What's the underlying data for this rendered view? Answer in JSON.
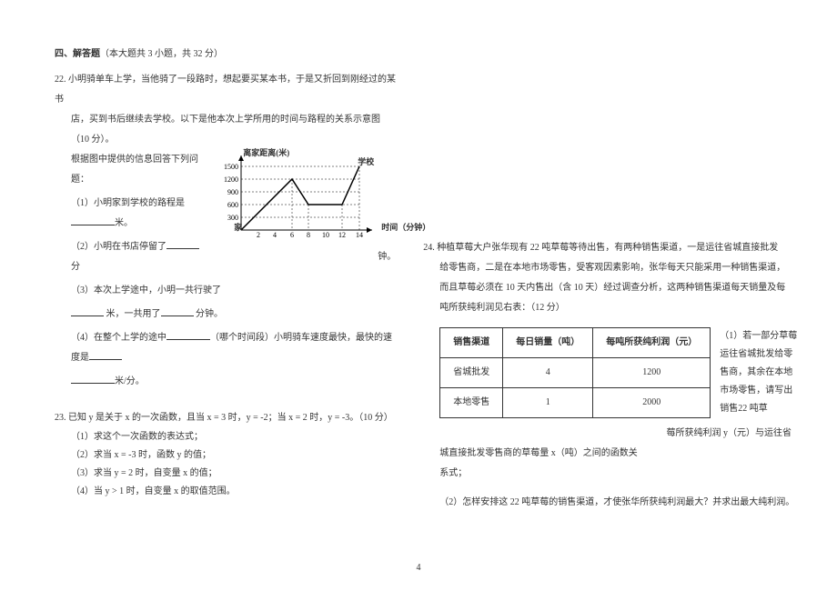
{
  "section": {
    "title": "四、解答题",
    "note": "（本大题共 3 小题，共 32 分）"
  },
  "q22": {
    "num": "22.",
    "intro": "小明骑单车上学，当他骑了一段路时，想起要买某本书，于是又折回到刚经过的某书",
    "line2": "店，买到书后继续去学校。以下是他本次上学所用的时间与路程的关系示意图（10 分）。",
    "line3": "根据图中提供的信息回答下列问题：",
    "s1": "（1）小明家到学校的路程是",
    "s1_unit": "米。",
    "s2": "（2）小明在书店停留了",
    "s2_unit1": "分",
    "s2_unit2": "钟。",
    "s3": "（3）本次上学途中，小明一共行驶了",
    "s3_unit1": "米，一共用了",
    "s3_unit2": "分钟。",
    "s4a": "（4）在整个上学的途中",
    "s4b": "（哪个时间段）小明骑车速度最快，最快的速度是",
    "s4_unit": "米/分。",
    "chart_y_label": "离家距离(米)",
    "chart_x_label": "时间（分钟）",
    "chart_school": "学校",
    "chart_home": "家"
  },
  "q23": {
    "num": "23.",
    "intro": "已知 y 是关于 x 的一次函数，且当 x = 3 时，y = -2；当 x = 2 时，y = -3。（10 分）",
    "s1": "（1）求这个一次函数的表达式；",
    "s2": "（2）求当 x = -3 时，函数 y 的值；",
    "s3": "（3）求当 y = 2 时，自变量 x 的值；",
    "s4": "（4）当 y > 1 时，自变量 x 的取值范围。"
  },
  "q24": {
    "num": "24.",
    "intro": "种植草莓大户张华现有 22 吨草莓等待出售，有两种销售渠道，一是运往省城直接批发",
    "line2": "给零售商，二是在本地市场零售，受客观因素影响，张华每天只能采用一种销售渠道，",
    "line3": "而且草莓必须在 10 天内售出（含 10 天）经过调查分析，这两种销售渠道每天销量及每",
    "line4": "吨所获纯利润见右表：（12 分）",
    "side1": "（1）若一部分草莓运往省城批发给零售商，其余在本地市场零售，请写出销售22 吨草",
    "tail1": "莓所获纯利润 y（元）与运往省",
    "tail2": "城直接批发零售商的草莓量 x（吨）之间的函数关",
    "tail3": "系式；",
    "s2": "（2）怎样安排这 22 吨草莓的销售渠道，才使张华所获纯利润最大？并求出最大纯利润。",
    "table": {
      "h1": "销售渠道",
      "h2": "每日销量（吨）",
      "h3": "每吨所获纯利润（元）",
      "r1c1": "省城批发",
      "r1c2": "4",
      "r1c3": "1200",
      "r2c1": "本地零售",
      "r2c2": "1",
      "r2c3": "2000"
    }
  },
  "pageno": "4",
  "chart_data": {
    "type": "line",
    "x": [
      0,
      6,
      8,
      12,
      14
    ],
    "y": [
      0,
      1200,
      600,
      600,
      1500
    ],
    "xlabel": "时间（分钟）",
    "ylabel": "离家距离(米)",
    "xticks": [
      2,
      4,
      6,
      8,
      10,
      12,
      14
    ],
    "yticks": [
      300,
      600,
      900,
      1200,
      1500
    ],
    "xlim": [
      0,
      14
    ],
    "ylim": [
      0,
      1500
    ]
  }
}
